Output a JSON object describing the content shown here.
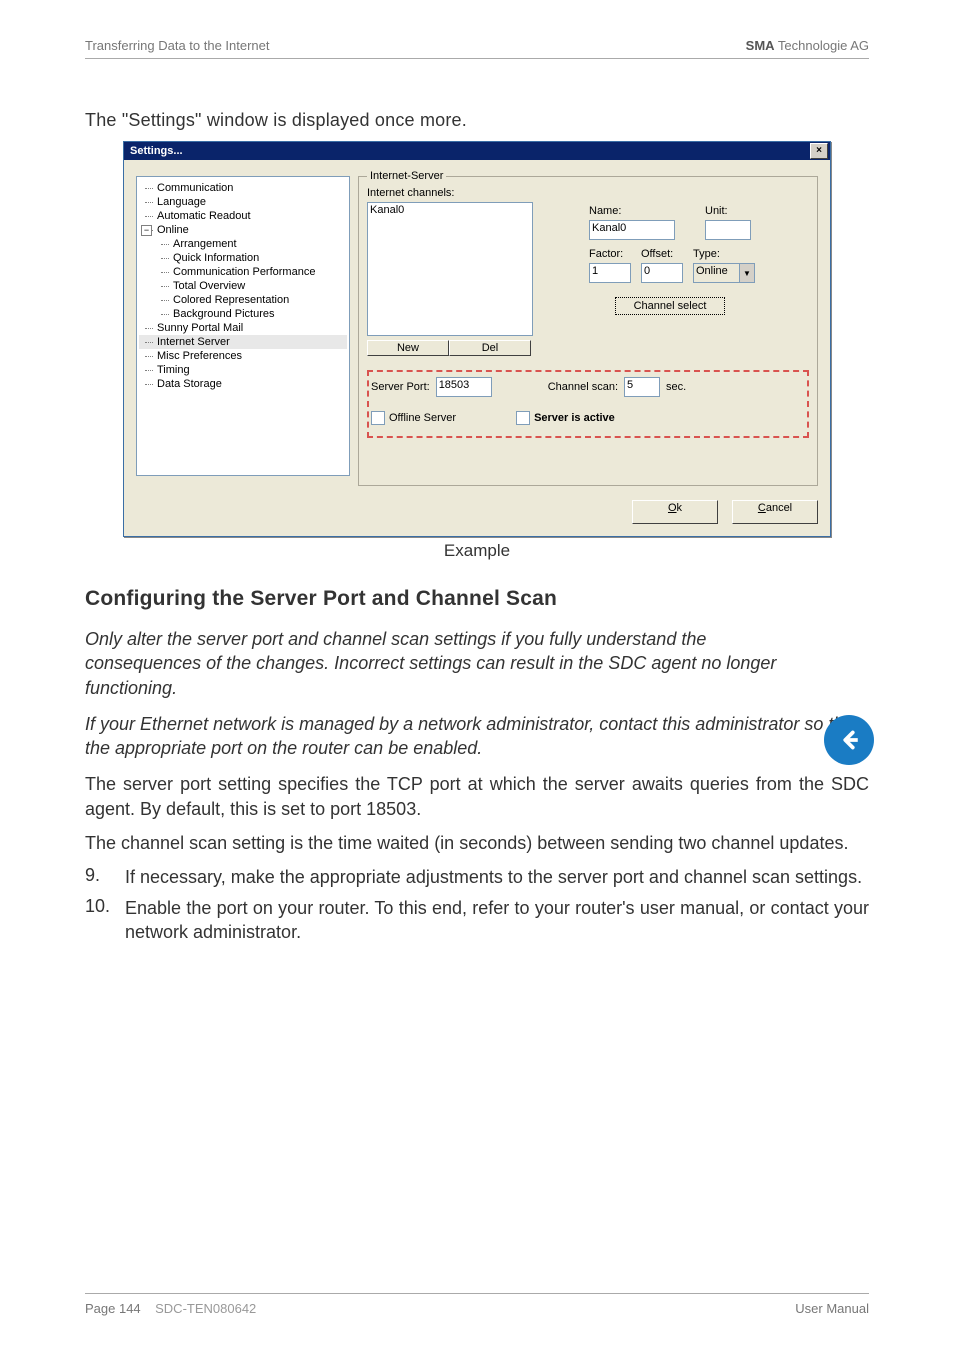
{
  "header": {
    "left": "Transferring Data to the Internet",
    "right_bold": "SMA",
    "right_rest": " Technologie AG"
  },
  "intro": "The \"Settings\" window is displayed once more.",
  "dialog": {
    "title": "Settings...",
    "close_glyph": "×",
    "tree": {
      "items": [
        {
          "label": "Communication",
          "indent": 0
        },
        {
          "label": "Language",
          "indent": 0
        },
        {
          "label": "Automatic Readout",
          "indent": 0
        },
        {
          "label": "Online",
          "indent": 0,
          "expander": true
        },
        {
          "label": "Arrangement",
          "indent": 1
        },
        {
          "label": "Quick Information",
          "indent": 1
        },
        {
          "label": "Communication Performance",
          "indent": 1
        },
        {
          "label": "Total Overview",
          "indent": 1
        },
        {
          "label": "Colored Representation",
          "indent": 1
        },
        {
          "label": "Background Pictures",
          "indent": 1
        },
        {
          "label": "Sunny Portal Mail",
          "indent": 0
        },
        {
          "label": "Internet Server",
          "indent": 0,
          "selected": true
        },
        {
          "label": "Misc Preferences",
          "indent": 0
        },
        {
          "label": "Timing",
          "indent": 0
        },
        {
          "label": "Data Storage",
          "indent": 0
        }
      ]
    },
    "group": {
      "legend": "Internet-Server",
      "channels_label": "Internet channels:",
      "channel_value": "Kanal0",
      "name_label": "Name:",
      "name_value": "Kanal0",
      "unit_label": "Unit:",
      "unit_value": "",
      "factor_label": "Factor:",
      "factor_value": "1",
      "offset_label": "Offset:",
      "offset_value": "0",
      "type_label": "Type:",
      "type_value": "Online",
      "channel_select_btn": "Channel select",
      "new_btn": "New",
      "del_btn": "Del",
      "server_port_label": "Server Port:",
      "server_port_value": "18503",
      "channel_scan_label": "Channel scan:",
      "channel_scan_value": "5",
      "sec_label": "sec.",
      "offline_server_label": "Offline Server",
      "server_active_label": "Server is active"
    },
    "ok": "Ok",
    "ok_accel": "O",
    "cancel": "Cancel",
    "cancel_accel": "C"
  },
  "caption": "Example",
  "section_title": "Configuring the Server Port and Channel Scan",
  "note1": "Only alter the server port and channel scan settings if you fully understand the consequences of the changes. Incorrect settings can result in the SDC agent no longer functioning.",
  "note2": "If your Ethernet network is managed by a network administrator, contact this administrator so that the appropriate port on the router can be enabled.",
  "para1": "The server port setting specifies the TCP port at which the server awaits queries from the SDC agent. By default, this is set to port 18503.",
  "para2": "The channel scan setting is the time waited (in seconds) between sending two channel updates.",
  "steps": [
    {
      "num": "9.",
      "text": "If necessary, make the appropriate adjustments to the server port and channel scan settings."
    },
    {
      "num": "10.",
      "text": "Enable the port on your router. To this end, refer to your router's user manual, or contact your network administrator."
    }
  ],
  "footer": {
    "left_page": "Page 144",
    "left_doc": "SDC-TEN080642",
    "right": "User Manual"
  }
}
